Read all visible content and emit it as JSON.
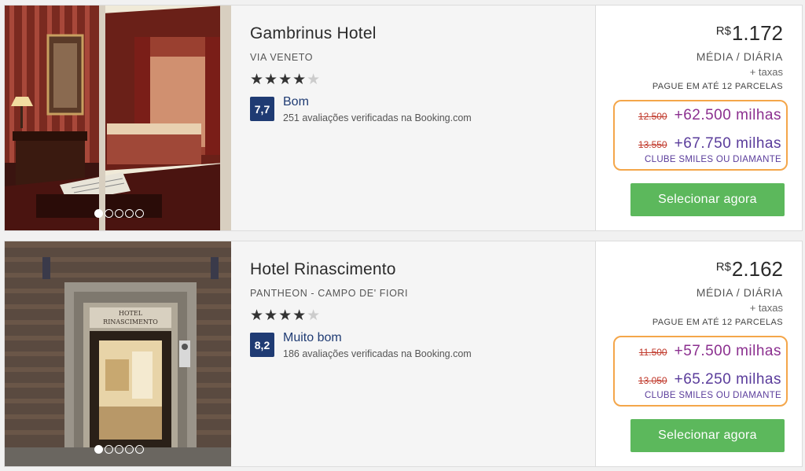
{
  "hotels": [
    {
      "name": "Gambrinus Hotel",
      "location": "VIA VENETO",
      "stars": 4,
      "stars_filled": "★★★★",
      "stars_empty": "★",
      "score": "7,7",
      "rating_label": "Bom",
      "reviews": "251 avaliações verificadas na Booking.com",
      "currency": "R$",
      "price": "1.172",
      "per_day": "MÉDIA / DIÁRIA",
      "taxes": "+ taxas",
      "installments": "PAGUE EM ATÉ 12 PARCELAS",
      "miles_old_1": "12.500",
      "miles_new_1": "+62.500 milhas",
      "miles_old_2": "13.550",
      "miles_new_2": "+67.750 milhas",
      "club_label": "CLUBE SMILES OU DIAMANTE",
      "button_label": "Selecionar agora",
      "photo_index": 1,
      "photo_count": 5
    },
    {
      "name": "Hotel Rinascimento",
      "location": "PANTHEON - CAMPO DE' FIORI",
      "stars": 4,
      "stars_filled": "★★★★",
      "stars_empty": "★",
      "score": "8,2",
      "rating_label": "Muito bom",
      "reviews": "186 avaliações verificadas na Booking.com",
      "currency": "R$",
      "price": "2.162",
      "per_day": "MÉDIA / DIÁRIA",
      "taxes": "+ taxas",
      "installments": "PAGUE EM ATÉ 12 PARCELAS",
      "miles_old_1": "11.500",
      "miles_new_1": "+57.500 milhas",
      "miles_old_2": "13.050",
      "miles_new_2": "+65.250 milhas",
      "club_label": "CLUBE SMILES OU DIAMANTE",
      "button_label": "Selecionar agora",
      "photo_index": 1,
      "photo_count": 5,
      "photo_sign": "HOTEL RINASCIMENTO"
    }
  ],
  "colors": {
    "score_bg": "#1f3b73",
    "button_bg": "#5cb85c",
    "miles_border": "#f4a64a",
    "miles_text": "#8b2f8f",
    "club_text": "#5a3c9b",
    "old_miles": "#c0392b"
  }
}
